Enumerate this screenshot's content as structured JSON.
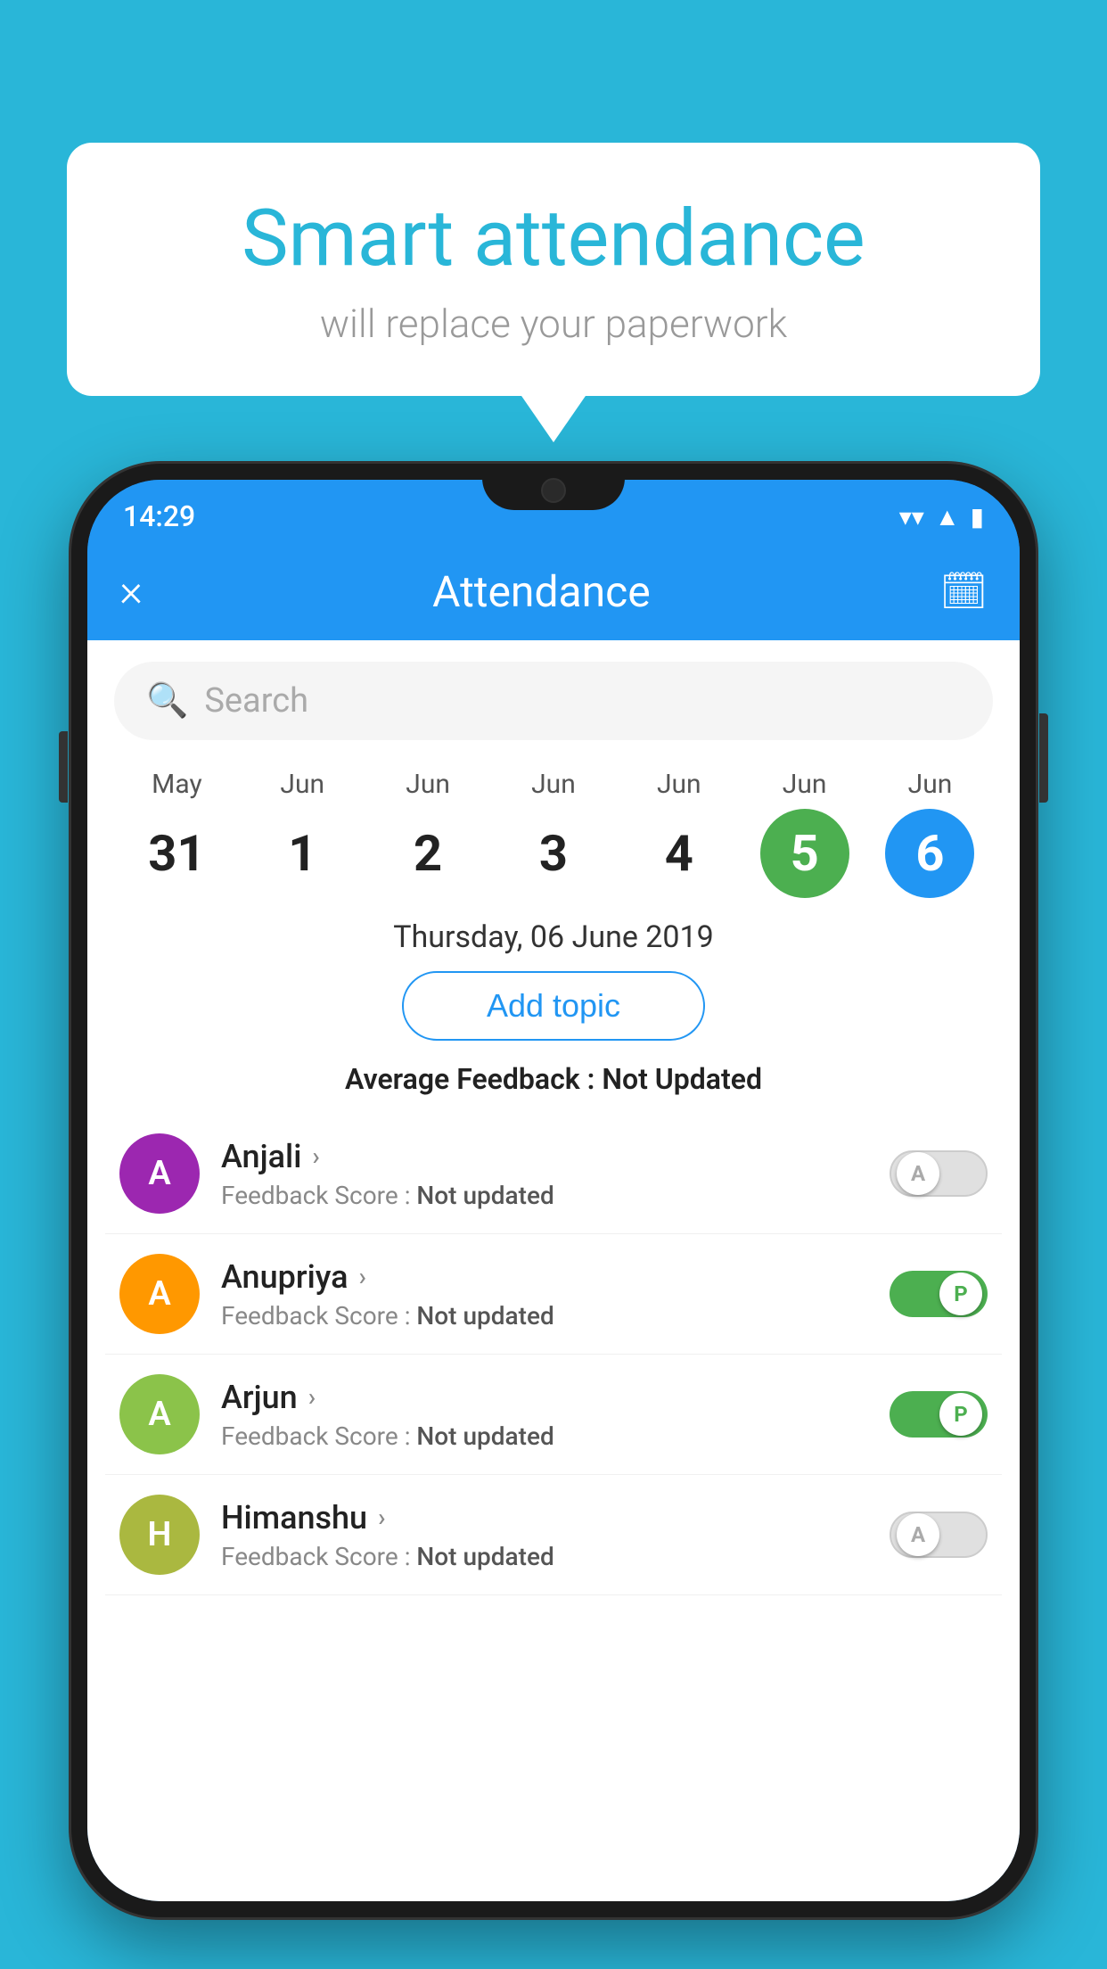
{
  "background_color": "#29b6d8",
  "speech_bubble": {
    "title": "Smart attendance",
    "subtitle": "will replace your paperwork"
  },
  "status_bar": {
    "time": "14:29",
    "wifi": "▼",
    "signal": "▲",
    "battery": "▮"
  },
  "app_bar": {
    "title": "Attendance",
    "close_icon": "×",
    "calendar_icon": "📅"
  },
  "search": {
    "placeholder": "Search"
  },
  "calendar": {
    "days": [
      {
        "month": "May",
        "date": "31",
        "highlight": ""
      },
      {
        "month": "Jun",
        "date": "1",
        "highlight": ""
      },
      {
        "month": "Jun",
        "date": "2",
        "highlight": ""
      },
      {
        "month": "Jun",
        "date": "3",
        "highlight": ""
      },
      {
        "month": "Jun",
        "date": "4",
        "highlight": ""
      },
      {
        "month": "Jun",
        "date": "5",
        "highlight": "green"
      },
      {
        "month": "Jun",
        "date": "6",
        "highlight": "blue"
      }
    ]
  },
  "selected_date": "Thursday, 06 June 2019",
  "add_topic_button": "Add topic",
  "avg_feedback_label": "Average Feedback : ",
  "avg_feedback_value": "Not Updated",
  "students": [
    {
      "name": "Anjali",
      "avatar_letter": "A",
      "avatar_color": "purple",
      "feedback_label": "Feedback Score : ",
      "feedback_value": "Not updated",
      "toggle_state": "off",
      "toggle_label": "A"
    },
    {
      "name": "Anupriya",
      "avatar_letter": "A",
      "avatar_color": "orange",
      "feedback_label": "Feedback Score : ",
      "feedback_value": "Not updated",
      "toggle_state": "on",
      "toggle_label": "P"
    },
    {
      "name": "Arjun",
      "avatar_letter": "A",
      "avatar_color": "light-green",
      "feedback_label": "Feedback Score : ",
      "feedback_value": "Not updated",
      "toggle_state": "on",
      "toggle_label": "P"
    },
    {
      "name": "Himanshu",
      "avatar_letter": "H",
      "avatar_color": "khaki",
      "feedback_label": "Feedback Score : ",
      "feedback_value": "Not updated",
      "toggle_state": "off",
      "toggle_label": "A"
    }
  ]
}
